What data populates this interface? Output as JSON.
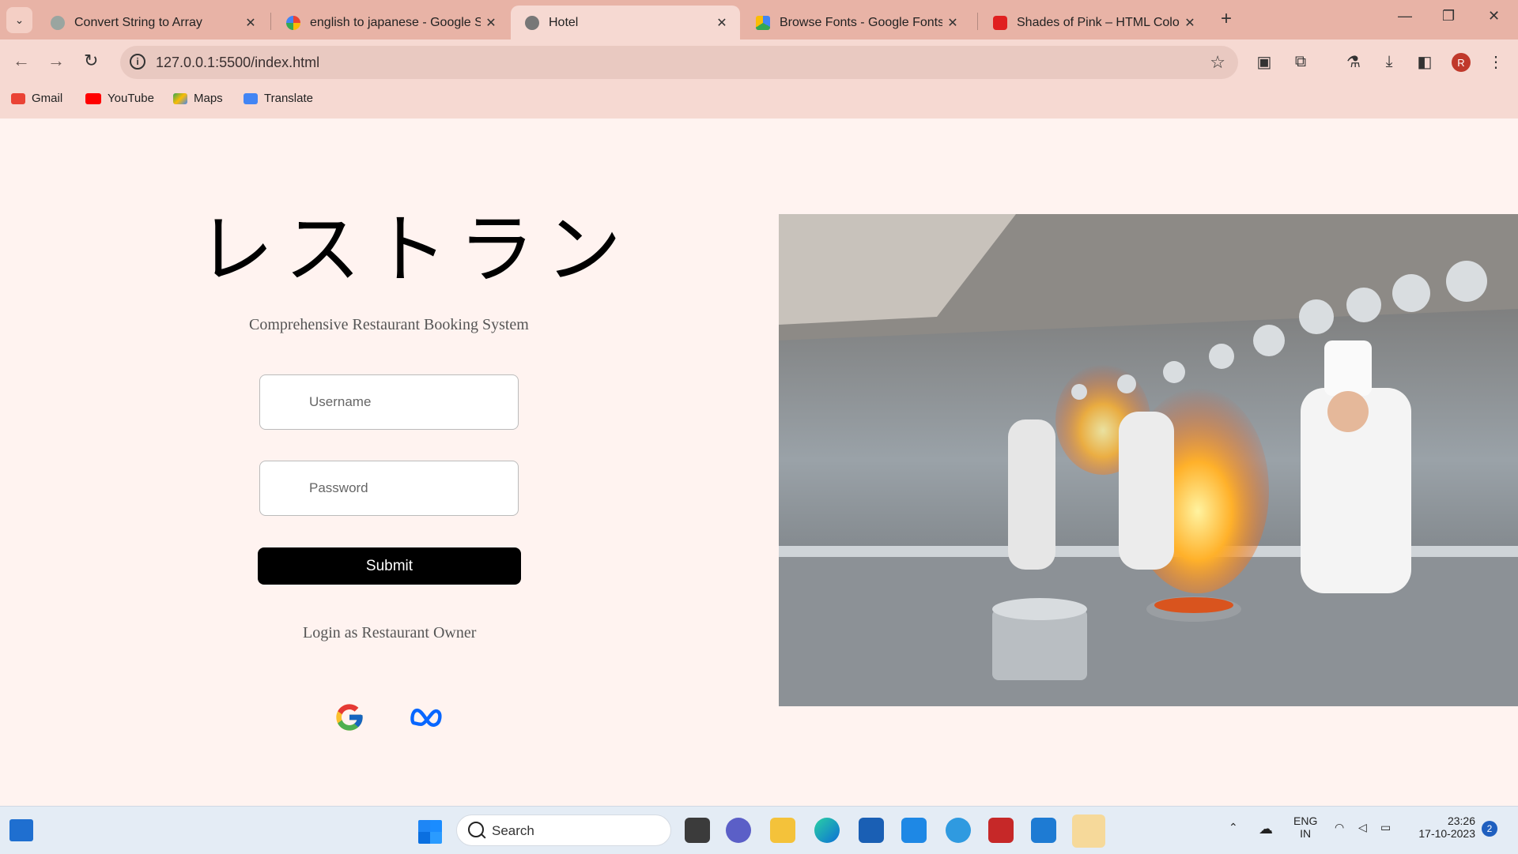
{
  "browser": {
    "tabs": [
      {
        "title": "Convert String to Array",
        "active": false,
        "color": "#a0a0a0"
      },
      {
        "title": "english to japanese - Google S",
        "active": false,
        "color": "#4285f4"
      },
      {
        "title": "Hotel",
        "active": true,
        "color": "#6b6b6b"
      },
      {
        "title": "Browse Fonts - Google Fonts",
        "active": false,
        "color": "#34a853"
      },
      {
        "title": "Shades of Pink – HTML Color C",
        "active": false,
        "color": "#e02020"
      }
    ],
    "close_glyph": "✕",
    "new_tab": "+",
    "url": "127.0.0.1:5500/index.html",
    "profile_initial": "R",
    "window_controls": {
      "minimize": "—",
      "restore": "❐",
      "close": "✕"
    }
  },
  "bookmarks": [
    {
      "label": "Gmail",
      "color": "#ea4335"
    },
    {
      "label": "YouTube",
      "color": "#ff0000"
    },
    {
      "label": "Maps",
      "color": "#34a853"
    },
    {
      "label": "Translate",
      "color": "#4285f4"
    }
  ],
  "page": {
    "title": "レストラン",
    "subtitle": "Comprehensive Restaurant Booking System",
    "username_placeholder": "Username",
    "password_placeholder": "Password",
    "submit_label": "Submit",
    "owner_link": "Login as Restaurant Owner",
    "social": [
      "google-icon",
      "meta-icon"
    ]
  },
  "taskbar": {
    "search_label": "Search",
    "language": "ENG",
    "region": "IN",
    "time": "23:26",
    "date": "17-10-2023",
    "notifications": "2"
  }
}
